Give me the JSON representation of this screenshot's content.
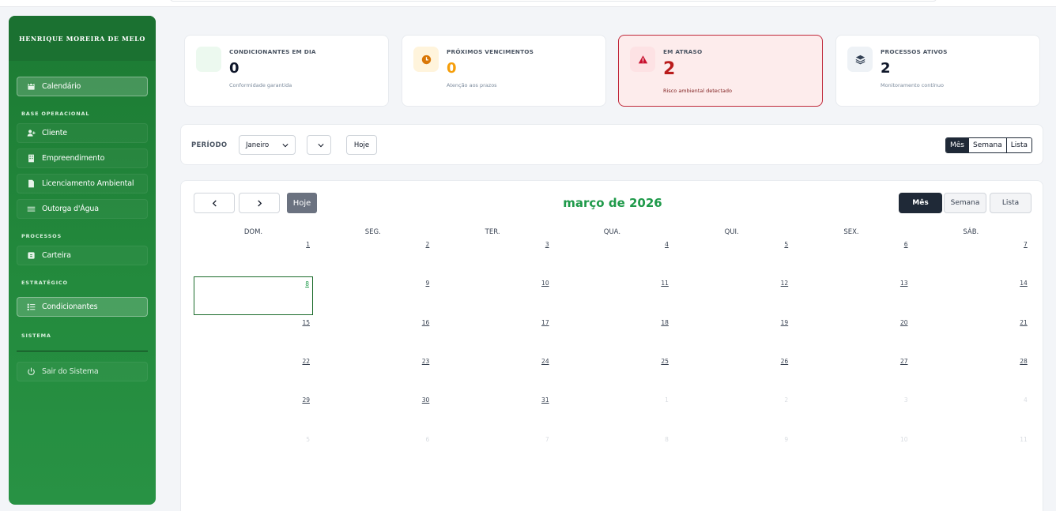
{
  "sidebar": {
    "user_name": "HENRIQUE MOREIRA DE MELO",
    "items": {
      "calendar": "Calendário",
      "client": "Cliente",
      "enterprise": "Empreendimento",
      "licensing": "Licenciamento Ambiental",
      "water": "Outorga d'Água",
      "portfolio": "Carteira",
      "conditions": "Condicionantes",
      "logout": "Sair do Sistema"
    },
    "sections": {
      "base": "BASE OPERACIONAL",
      "processes": "PROCESSOS",
      "strategic": "ESTRATÉGICO",
      "system": "SISTEMA"
    },
    "active_item": "Calendário"
  },
  "stats": [
    {
      "label": "CONDICIONANTES EM DIA",
      "value": "0",
      "sub": "Conformidade garantida",
      "color": "#111827",
      "icon": "check-icon"
    },
    {
      "label": "PRÓXIMOS VENCIMENTOS",
      "value": "0",
      "sub": "Atenção aos prazos",
      "color": "#f59e0b",
      "icon": "clock-icon"
    },
    {
      "label": "EM ATRASO",
      "value": "2",
      "sub": "Risco ambiental detectado",
      "color": "#b91c1c",
      "icon": "warning-icon"
    },
    {
      "label": "PROCESSOS ATIVOS",
      "value": "2",
      "sub": "Monitoramento contínuo",
      "color": "#111827",
      "icon": "layers-icon"
    }
  ],
  "period": {
    "label": "PERÍODO",
    "month": "Janeiro",
    "year": "",
    "today_label": "Hoje",
    "views": [
      "Mês",
      "Semana",
      "Lista"
    ],
    "active_view": "Mês"
  },
  "calendar": {
    "title": "março de 2026",
    "today_label": "Hoje",
    "views": [
      "Mês",
      "Semana",
      "Lista"
    ],
    "active_view": "Mês",
    "weekdays": [
      "DOM.",
      "SEG.",
      "TER.",
      "QUA.",
      "QUI.",
      "SEX.",
      "SÁB."
    ],
    "weeks": [
      [
        "1",
        "2",
        "3",
        "4",
        "5",
        "6",
        "7"
      ],
      [
        "8",
        "9",
        "10",
        "11",
        "12",
        "13",
        "14"
      ],
      [
        "15",
        "16",
        "17",
        "18",
        "19",
        "20",
        "21"
      ],
      [
        "22",
        "23",
        "24",
        "25",
        "26",
        "27",
        "28"
      ],
      [
        "29",
        "30",
        "31",
        "1",
        "2",
        "3",
        "4"
      ],
      [
        "5",
        "6",
        "7",
        "8",
        "9",
        "10",
        "11"
      ]
    ],
    "today": "8",
    "accent": "#1f9a4a"
  }
}
